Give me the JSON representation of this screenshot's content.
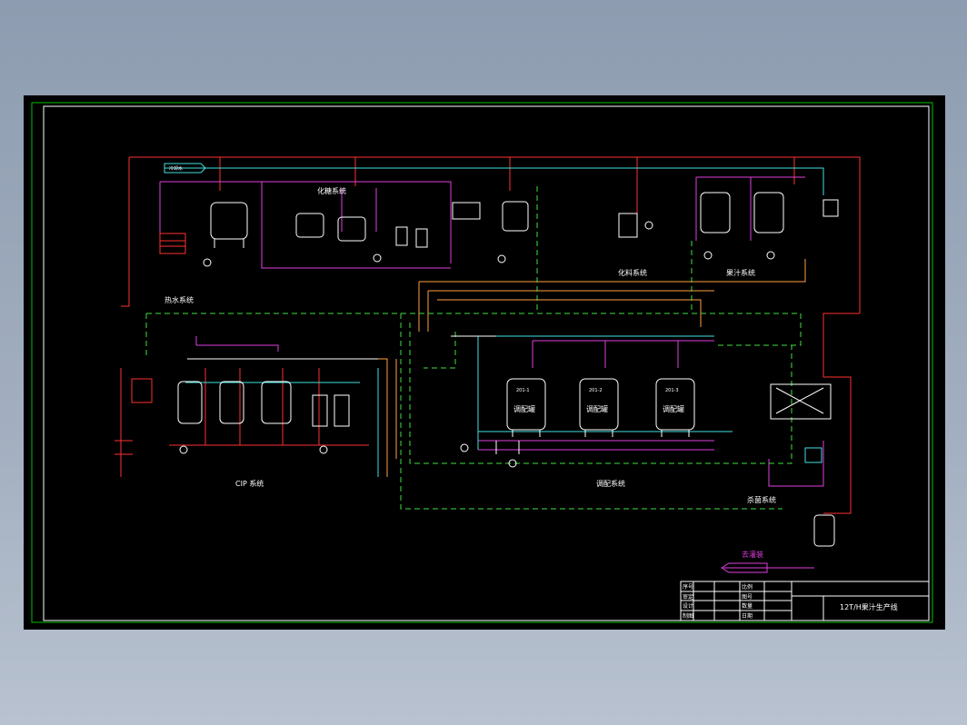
{
  "drawing": {
    "title": "12T/H果汁生产线",
    "sections": {
      "sugar": "化糖系统",
      "hot_water": "热水系统",
      "ingredients": "化料系统",
      "juice": "果汁系统",
      "cip": "CIP 系统",
      "blending": "调配系统",
      "sterilization": "杀菌系统"
    },
    "tank_label": "调配罐",
    "tank_ids": [
      "201-1",
      "201-2",
      "201-3"
    ],
    "to_filling": "去灌装",
    "cold_water": "冷却水",
    "title_block": {
      "row1": [
        "序号",
        "比例"
      ],
      "row2": [
        "审定",
        "图号"
      ],
      "row3": [
        "设计",
        "数量"
      ],
      "row4": [
        "制图",
        "日期"
      ]
    }
  },
  "colors": {
    "frame": "#00c000",
    "red": "#ff3030",
    "magenta": "#e040e0",
    "green_dash": "#40e040",
    "cyan": "#40e0e0",
    "yellow": "#ffd040",
    "orange": "#ffa040",
    "white": "#ffffff"
  }
}
